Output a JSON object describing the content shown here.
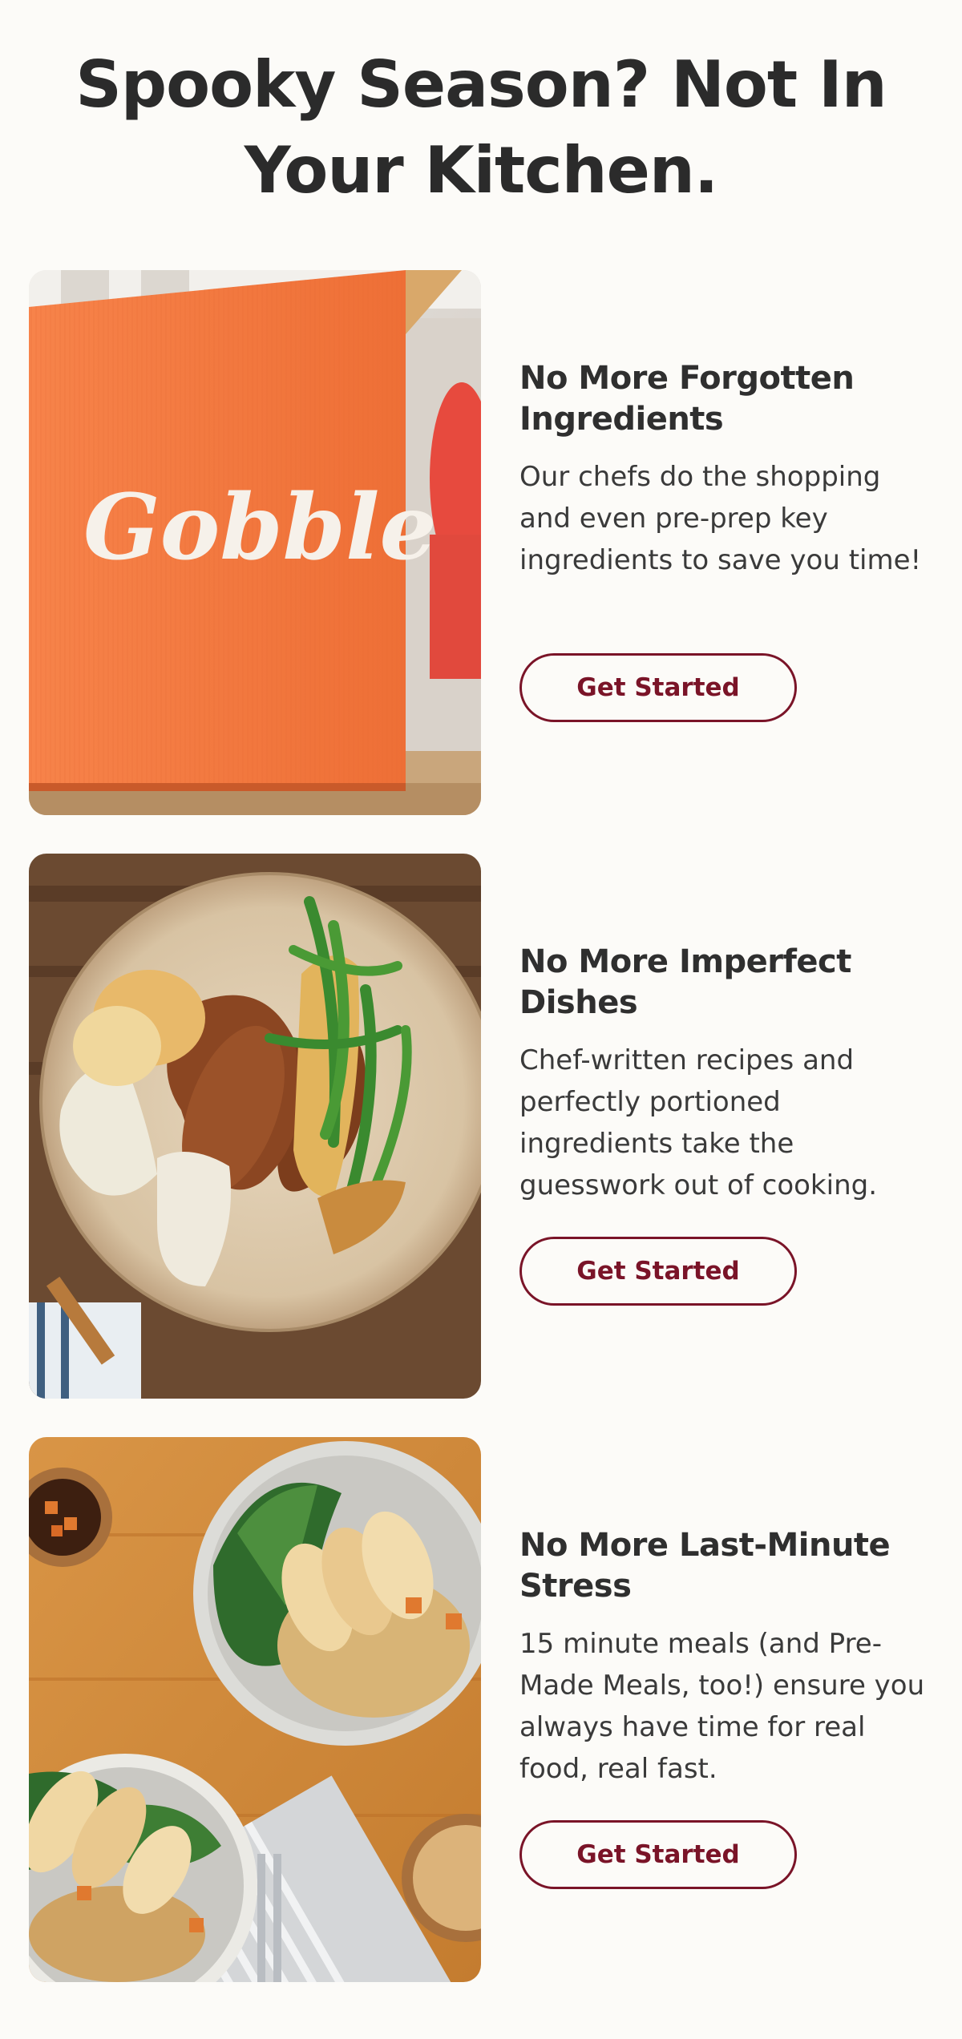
{
  "headline": "Spooky Season? Not In Your Kitchen.",
  "colors": {
    "background": "#fcfbf8",
    "text": "#2b2b2b",
    "button_accent": "#7a1428",
    "box_orange": "#f47a3f"
  },
  "features": [
    {
      "title": "No More Forgotten Ingredients",
      "description": "Our chefs do the shopping and even pre-prep key ingredients to save you time!",
      "button_label": "Get Started",
      "image": {
        "subject": "orange-meal-kit-box-photo",
        "brand_text": "Gobble"
      }
    },
    {
      "title": "No More Imperfect Dishes",
      "description": "Chef-written recipes and perfectly portioned ingredients take the guesswork out of cooking.",
      "button_label": "Get Started",
      "image": {
        "subject": "pork-chop-biscuit-green-beans-plate-photo"
      }
    },
    {
      "title": "No More Last-Minute Stress",
      "description": "15 minute meals (and Pre-Made Meals, too!) ensure you always have time for real food, real fast.",
      "button_label": "Get Started",
      "image": {
        "subject": "chicken-fried-rice-bok-choy-plates-photo"
      }
    }
  ]
}
